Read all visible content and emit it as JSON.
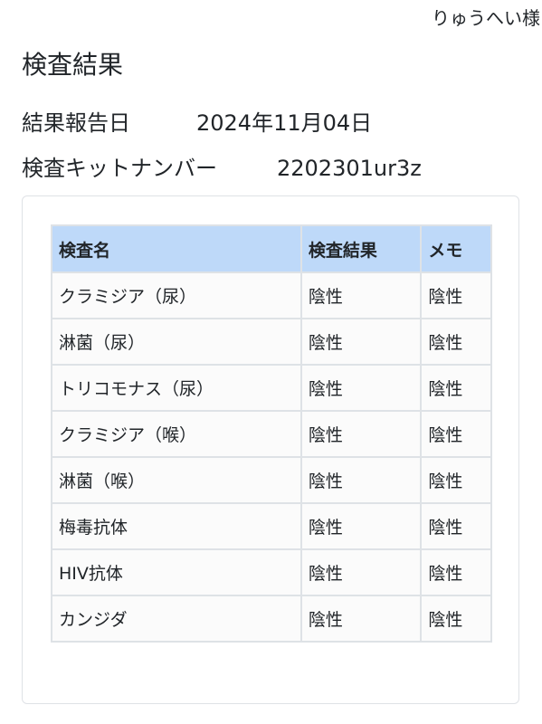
{
  "header": {
    "user_name": "りゅうへい様"
  },
  "page": {
    "title": "検査結果",
    "report_date_label": "結果報告日",
    "report_date_value": "2024年11月04日",
    "kit_number_label": "検査キットナンバー",
    "kit_number_value": "2202301ur3z"
  },
  "table": {
    "columns": [
      "検査名",
      "検査結果",
      "メモ"
    ],
    "header_color": "#bed9f9",
    "rows": [
      {
        "name": "クラミジア（尿）",
        "result": "陰性",
        "memo": "陰性"
      },
      {
        "name": "淋菌（尿）",
        "result": "陰性",
        "memo": "陰性"
      },
      {
        "name": "トリコモナス（尿）",
        "result": "陰性",
        "memo": "陰性"
      },
      {
        "name": "クラミジア（喉）",
        "result": "陰性",
        "memo": "陰性"
      },
      {
        "name": "淋菌（喉）",
        "result": "陰性",
        "memo": "陰性"
      },
      {
        "name": "梅毒抗体",
        "result": "陰性",
        "memo": "陰性"
      },
      {
        "name": "HIV抗体",
        "result": "陰性",
        "memo": "陰性"
      },
      {
        "name": "カンジダ",
        "result": "陰性",
        "memo": "陰性"
      }
    ]
  }
}
